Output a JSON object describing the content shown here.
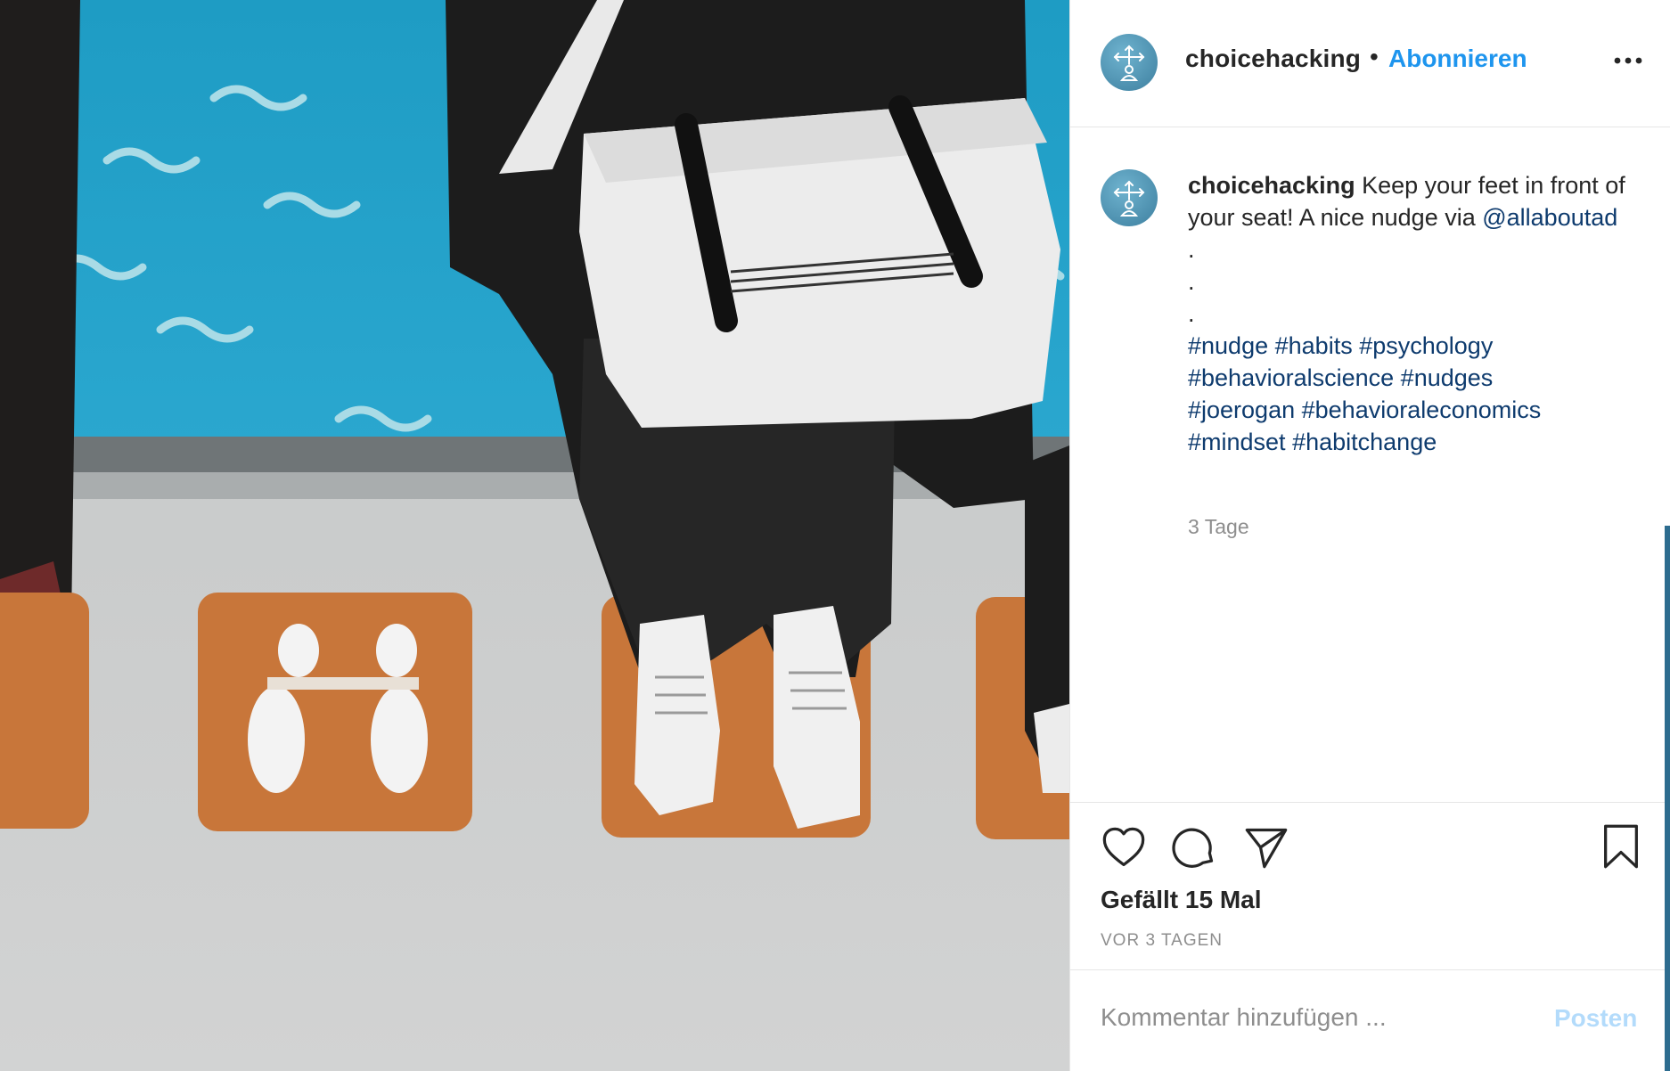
{
  "post": {
    "username": "choicehacking",
    "separator": "•",
    "follow_label": "Abonnieren",
    "more_label": "...",
    "caption": {
      "username": "choicehacking",
      "text": " Keep your feet in front of your seat! A nice nudge via ",
      "mention": "@allaboutad",
      "dots": [
        ".",
        ".",
        "."
      ],
      "hashtags": [
        "#nudge",
        "#habits",
        "#psychology",
        "#behavioralscience",
        "#nudges",
        "#joerogan",
        "#behavioraleconomics",
        "#mindset",
        "#habitchange"
      ]
    },
    "caption_age": "3 Tage",
    "likes_text": "Gefällt 15 Mal",
    "posted_ago": "VOR 3 TAGEN",
    "comment_placeholder": "Kommentar hinzufügen ...",
    "post_button_label": "Posten"
  },
  "icons": {
    "avatar": "choicehacking-logo-icon",
    "like": "heart-icon",
    "comment": "comment-bubble-icon",
    "share": "paper-plane-icon",
    "save": "bookmark-icon",
    "more": "more-dots-icon"
  },
  "colors": {
    "link": "#1e95ee",
    "hashtag": "#0e3b6e",
    "text": "#262626",
    "muted": "#8e8e8e",
    "post_disabled": "#b3dbfb"
  }
}
